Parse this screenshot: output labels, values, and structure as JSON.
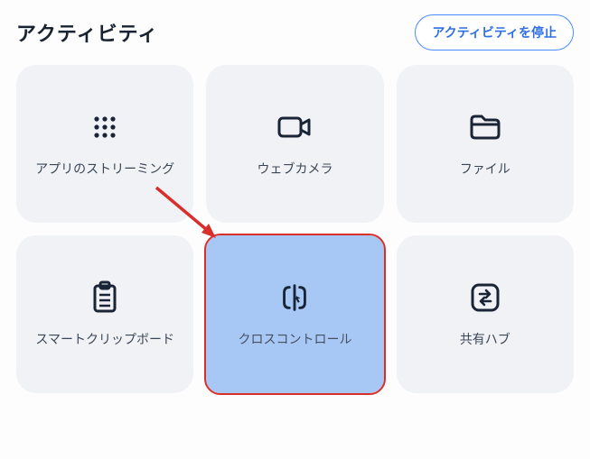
{
  "header": {
    "title": "アクティビティ",
    "stop_label": "アクティビティを停止"
  },
  "tiles": {
    "app_streaming": {
      "label": "アプリのストリーミング",
      "icon": "app-grid-icon"
    },
    "webcam": {
      "label": "ウェブカメラ",
      "icon": "camera-icon"
    },
    "file": {
      "label": "ファイル",
      "icon": "folder-icon"
    },
    "smart_clip": {
      "label": "スマートクリップボード",
      "icon": "clipboard-icon"
    },
    "cross_control": {
      "label": "クロスコントロール",
      "icon": "cross-control-icon",
      "selected": true
    },
    "share_hub": {
      "label": "共有ハブ",
      "icon": "swap-icon"
    }
  },
  "annotation": {
    "arrow_color": "#d92f2b"
  }
}
